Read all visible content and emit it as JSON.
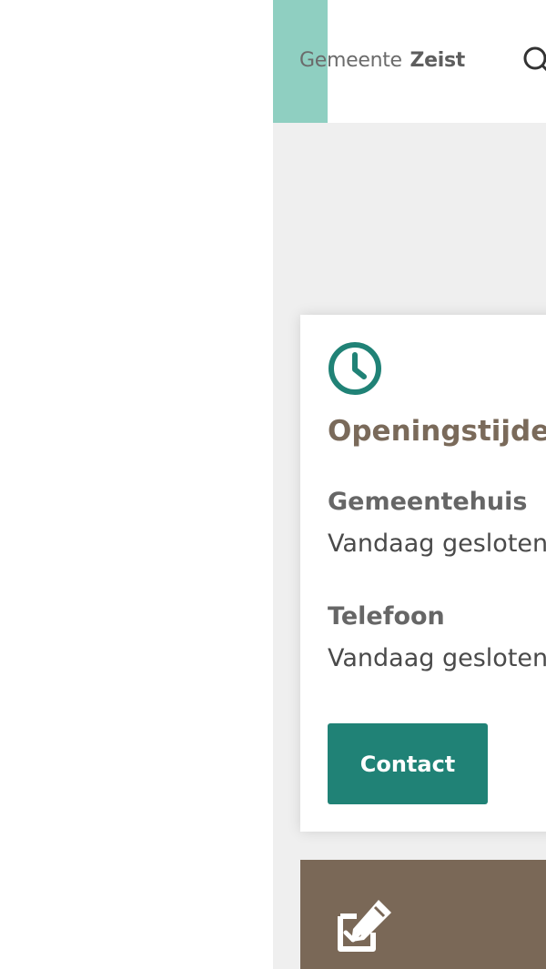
{
  "header": {
    "logo_prefix": "Gemeente",
    "logo_name": "Zeist",
    "search_icon": "search-icon"
  },
  "opening_hours": {
    "icon": "clock-icon",
    "title": "Openingstijden",
    "rows": [
      {
        "label": "Gemeentehuis",
        "value": "Vandaag gesloten"
      },
      {
        "label": "Telefoon",
        "value": "Vandaag gesloten"
      }
    ],
    "contact_label": "Contact"
  },
  "next_card": {
    "icon": "edit-form-icon"
  },
  "colors": {
    "teal": "#208276",
    "mint": "#8fcfc1",
    "brown": "#7a6857",
    "title_brown": "#7a6a5a",
    "background": "#efefef"
  }
}
